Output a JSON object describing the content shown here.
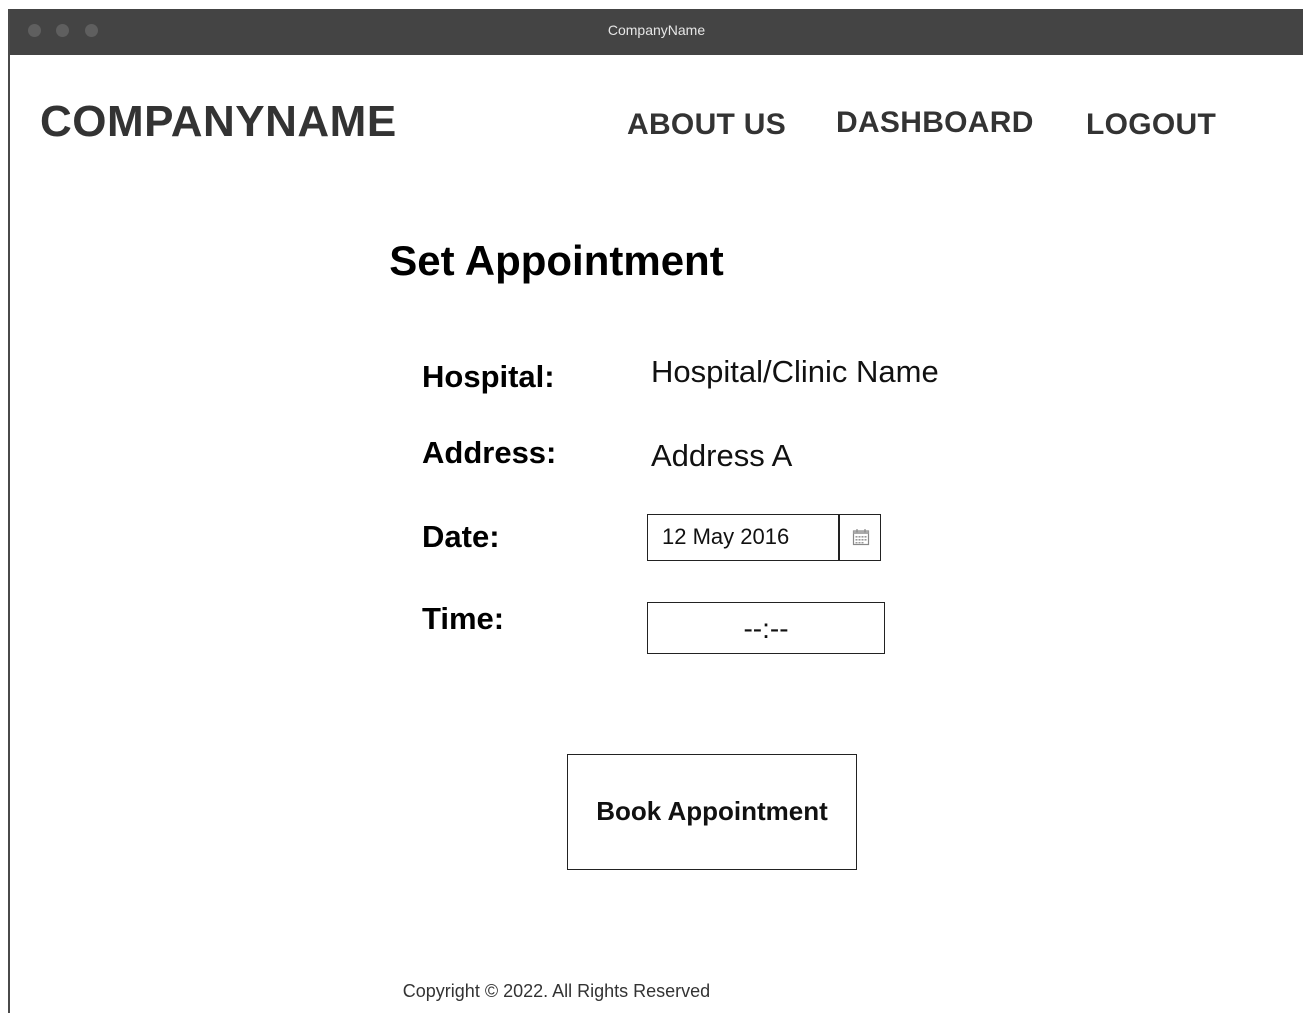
{
  "window": {
    "title": "CompanyName"
  },
  "header": {
    "brand": "COMPANYNAME",
    "nav": [
      {
        "label": "ABOUT US"
      },
      {
        "label": "DASHBOARD"
      },
      {
        "label": "LOGOUT"
      }
    ]
  },
  "main": {
    "title": "Set Appointment",
    "hospital_label": "Hospital:",
    "hospital_value": "Hospital/Clinic Name",
    "address_label": "Address:",
    "address_value": "Address A",
    "date_label": "Date:",
    "date_value": "12 May 2016",
    "time_label": "Time:",
    "time_value": "--:--",
    "book_button_label": "Book Appointment"
  },
  "footer": {
    "copyright": "Copyright  © 2022. All Rights Reserved"
  },
  "icons": {
    "calendar": "calendar-icon"
  }
}
